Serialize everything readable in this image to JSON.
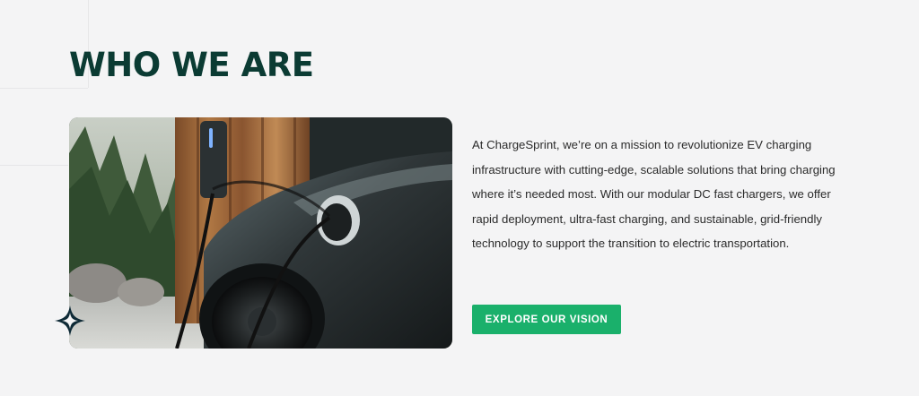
{
  "section": {
    "title": "WHO WE ARE",
    "description": "At ChargeSprint, we’re on a mission to revolutionize EV charging infrastructure with cutting-edge, scalable solutions that bring charging where it’s needed most. With our modular DC fast chargers, we offer rapid deployment, ultra-fast charging, and sustainable, grid-friendly technology to support the transition to electric transportation.",
    "cta_label": "EXPLORE OUR VISION"
  },
  "image": {
    "subject": "electric car charging at wall-mounted charger"
  },
  "icons": {
    "decoration": "sparkle-icon"
  },
  "colors": {
    "title": "#0b3b33",
    "button": "#1ab06b",
    "background": "#f4f4f5",
    "text": "#2b2b2b"
  }
}
